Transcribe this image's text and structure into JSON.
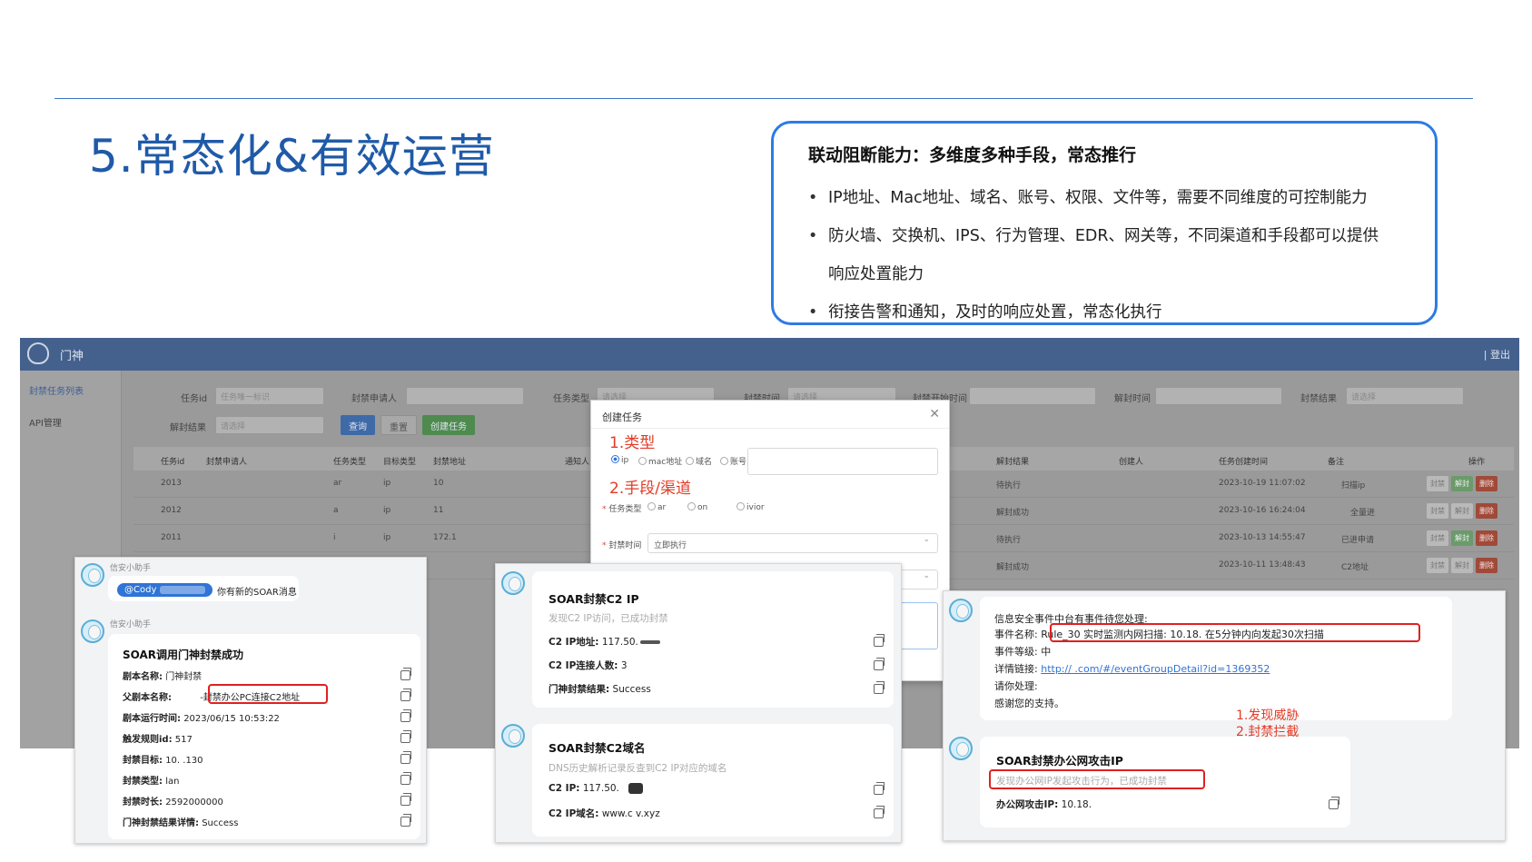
{
  "slide": {
    "title": "5.常态化&有效运营",
    "capability": {
      "heading": "联动阻断能力：多维度多种手段，常态推行",
      "bullets": [
        "IP地址、Mac地址、域名、账号、权限、文件等，需要不同维度的可控制能力",
        "防火墙、交换机、IPS、行为管理、EDR、网关等，不同渠道和手段都可以提供",
        "响应处置能力",
        "衔接告警和通知，及时的响应处置，常态化执行"
      ]
    }
  },
  "app": {
    "name": "门神",
    "logout": "| 登出",
    "sidebar": [
      "封禁任务列表",
      "API管理"
    ],
    "filters": {
      "task_id_label": "任务id",
      "task_id_placeholder": "任务唯一标识",
      "applicant_label": "封禁申请人",
      "task_type_label": "任务类型",
      "task_type_placeholder": "请选择",
      "ban_time_label": "封禁时间",
      "ban_time_placeholder": "请选择",
      "ban_start_label": "封禁开始时间",
      "unban_time_label": "解封时间",
      "result_label": "封禁结果",
      "result_placeholder": "请选择",
      "unban_result_label": "解封结果",
      "unban_result_placeholder": "请选择",
      "query_button": "查询",
      "reset_button": "重置",
      "create_button": "创建任务"
    },
    "table": {
      "headers": [
        "任务id",
        "封禁申请人",
        "任务类型",
        "目标类型",
        "封禁地址",
        "通知人",
        "解封结果",
        "创建人",
        "任务创建时间",
        "备注",
        "操作"
      ],
      "rows": [
        {
          "id": "2013",
          "type": "ar",
          "target": "ip",
          "addr": "10",
          "result": "待执行",
          "time": "2023-10-19 11:07:02",
          "note": "扫描ip"
        },
        {
          "id": "2012",
          "type": "a",
          "target": "ip",
          "addr": "11",
          "result": "解封成功",
          "time": "2023-10-16 16:24:04",
          "note": "全量进"
        },
        {
          "id": "2011",
          "type": "i",
          "target": "ip",
          "addr": "172.1",
          "result": "待执行",
          "time": "2023-10-13 14:55:47",
          "note": "已进申请"
        },
        {
          "id": "",
          "type": "",
          "target": "",
          "addr": "",
          "result": "解封成功",
          "time": "2023-10-11 13:48:43",
          "note": "C2地址"
        }
      ],
      "ops": [
        "封禁",
        "解封",
        "删除"
      ]
    }
  },
  "modal": {
    "title": "创建任务",
    "note_type": "1.类型",
    "note_channel": "2.手段/渠道",
    "radios": [
      "ip",
      "mac地址",
      "域名",
      "账号"
    ],
    "task_type_label": "任务类型",
    "task_type_options": [
      "ar",
      "on",
      "ivior"
    ],
    "ban_time_label": "封禁时间",
    "ban_time_value": "立即执行"
  },
  "panel1": {
    "sender1": "信安小助手",
    "mention": "@Cody",
    "message": "你有新的SOAR消息",
    "sender2": "信安小助手",
    "card_title": "SOAR调用门神封禁成功",
    "fields": [
      {
        "k": "剧本名称:",
        "v": "门神封禁"
      },
      {
        "k": "父剧本名称:",
        "v": "-封禁办公PC连接C2地址"
      },
      {
        "k": "剧本运行时间:",
        "v": "2023/06/15 10:53:22"
      },
      {
        "k": "触发规则id:",
        "v": "517"
      },
      {
        "k": "封禁目标:",
        "v": "10.          .130"
      },
      {
        "k": "封禁类型:",
        "v": "lan"
      },
      {
        "k": "封禁时长:",
        "v": "2592000000"
      },
      {
        "k": "门神封禁结果详情:",
        "v": "Success"
      }
    ]
  },
  "panel2": {
    "card1": {
      "title": "SOAR封禁C2 IP",
      "subtitle": "发现C2 IP访问，已成功封禁",
      "fields": [
        {
          "k": "C2 IP地址:",
          "v": "117.50."
        },
        {
          "k": "C2 IP连接人数:",
          "v": "3"
        },
        {
          "k": "门神封禁结果:",
          "v": "Success"
        }
      ]
    },
    "card2": {
      "title": "SOAR封禁C2域名",
      "subtitle": "DNS历史解析记录反查到C2 IP对应的域名",
      "fields": [
        {
          "k": "C2 IP:",
          "v": "117.50."
        },
        {
          "k": "C2 IP域名:",
          "v": "www.c                  v.xyz"
        }
      ]
    }
  },
  "panel3": {
    "intro": "信息安全事件中台有事件待您处理:",
    "event_name_label": "事件名称:",
    "event_name_value": "Rule_30 实时监测内网扫描: 10.18.      在5分钟内向发起30次扫描",
    "level_label": "事件等级:",
    "level_value": "中",
    "link_label": "详情链接:",
    "link_value": "http://                                    .com/#/eventGroupDetail?id=1369352",
    "please": "请你处理:",
    "thanks": "感谢您的支持。",
    "note1": "1.发现威胁",
    "note2": "2.封禁拦截",
    "card_title": "SOAR封禁办公网攻击IP",
    "card_subtitle": "发现办公网IP发起攻击行为，已成功封禁",
    "attack_label": "办公网攻击IP:",
    "attack_value": "10.18."
  },
  "colors": {
    "accent": "#2c7be5",
    "title": "#1f5aa8",
    "alert": "#e02020"
  }
}
